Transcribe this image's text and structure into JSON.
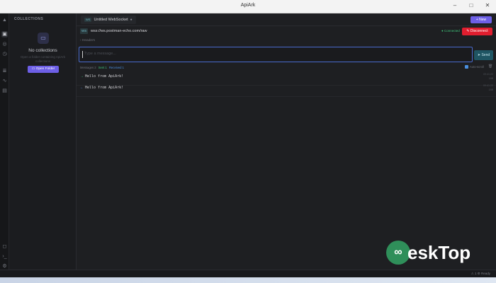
{
  "window": {
    "title": "ApiArk",
    "minimize": "–",
    "maximize": "□",
    "close": "✕"
  },
  "iconbar": {
    "items": [
      "collections-icon",
      "globe-icon",
      "history-icon",
      "database-icon",
      "activity-icon",
      "document-icon",
      "chat-icon",
      "terminal-icon",
      "settings-icon"
    ]
  },
  "sidebar": {
    "heading": "COLLECTIONS",
    "empty_title": "No collections",
    "empty_subtitle": "Open a folder containing ApiArk collections",
    "open_folder_label": "Open Folder"
  },
  "tabs": [
    {
      "badge": "WS",
      "label": "Untitled WebSocket"
    }
  ],
  "new_button": "+ New",
  "request": {
    "protocol_badge": "WS",
    "url": "wss://ws.postman-echo.com/raw",
    "status": "● Connected",
    "disconnect_label": "Disconnect"
  },
  "headers_toggle": "› Headers",
  "composer": {
    "placeholder": "Type a message...",
    "send_label": "Send"
  },
  "counts": {
    "messages": "Messages 2",
    "sent": "Sent 1",
    "received": "Received 1"
  },
  "autoscroll_label": "Auto-scroll",
  "messages": [
    {
      "direction": "sent",
      "arrow": "→",
      "text": "Hello from ApiArk!",
      "time": "09:41:22",
      "size": "18B"
    },
    {
      "direction": "received",
      "arrow": "←",
      "text": "Hello from ApiArk!",
      "time": "09:41:22",
      "size": "18B"
    }
  ],
  "statusbar": {
    "right": "⚠ 1   ⚙   Ready"
  },
  "watermark": {
    "glyph": "∞",
    "text": "eskTop"
  },
  "colors": {
    "accent": "#6d5fe6",
    "danger": "#e01e2f",
    "connected": "#3ec47a",
    "input_focus": "#4a6ccf"
  }
}
